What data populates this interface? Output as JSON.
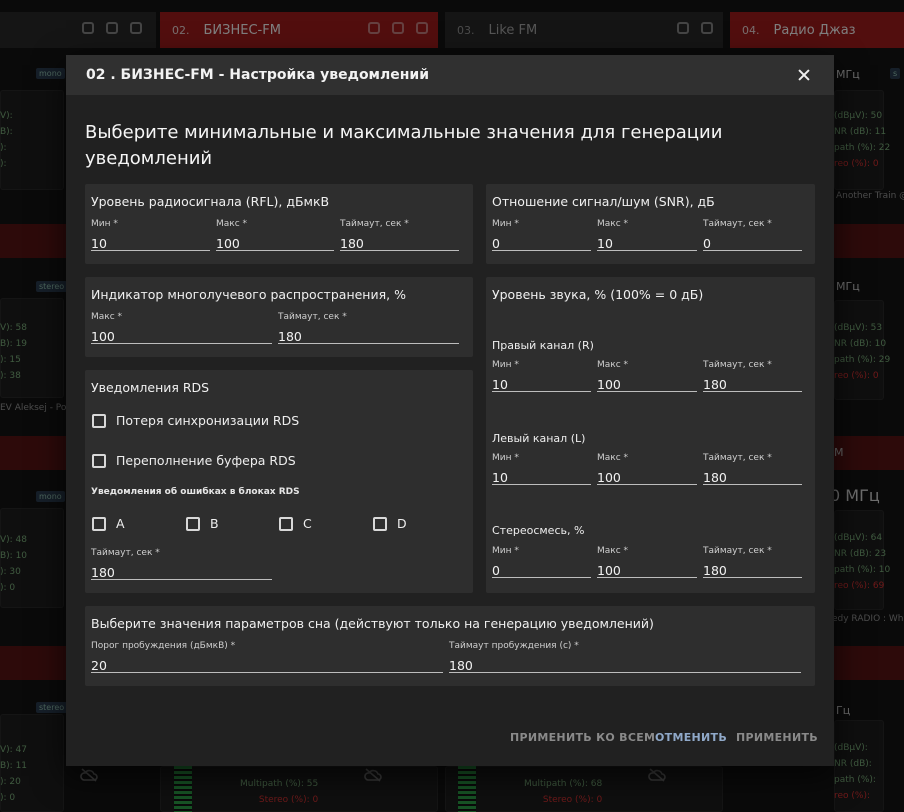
{
  "background": {
    "stations": [
      {
        "num": "02.",
        "name": "БИЗНЕС-FM"
      },
      {
        "num": "03.",
        "name": "Like FM"
      },
      {
        "num": "04.",
        "name": "Радио Джаз"
      }
    ],
    "tags": {
      "mono": "mono",
      "stereo": "stereo"
    },
    "freq_unit": "МГц",
    "freq_big": "0 МГц",
    "freq_mid": "Гц",
    "left_values": {
      "r1": [
        "V):",
        "B):",
        "):",
        "):"
      ],
      "r2": [
        "V): 58",
        "B): 19",
        "): 15",
        "): 38"
      ],
      "r3": [
        "V): 48",
        "B): 10",
        "): 30",
        "): 0"
      ],
      "r4": [
        "V): 47",
        "B): 11",
        "): 20",
        "): 0"
      ]
    },
    "right_values": {
      "r1": [
        "(dBµV): 50",
        "NR (dB): 11",
        "path (%): 22",
        "reo (%): 0"
      ],
      "r2": [
        "(dBµV): 53",
        "NR (dB): 10",
        "path (%): 29",
        "reo (%): 0"
      ],
      "r3": [
        "(dBµV): 64",
        "NR (dB): 23",
        "path (%): 10",
        "reo (%): 69"
      ],
      "r4": [
        "(dBµV):",
        "NR (dB):",
        "path (%):",
        "reo (%):"
      ]
    },
    "texts": {
      "another_train": "Another Train @",
      "aleksej": "EV Aleksej - Poz",
      "edy_radio": "edy RADIO : Wh",
      "multipath_1": "Multipath (%): 55",
      "stereo_1": "Stereo (%): 0",
      "multipath_2": "Multipath (%): 68",
      "stereo_2": "Stereo (%): 0",
      "m_letter": "M"
    }
  },
  "dialog": {
    "title": "02 . БИЗНЕС-FM - Настройка уведомлений",
    "heading": "Выберите минимальные и максимальные значения для генерации уведомлений",
    "rfl": {
      "title": "Уровень радиосигнала (RFL), дБмкВ",
      "min": {
        "label": "Мин *",
        "value": "10"
      },
      "max": {
        "label": "Макс *",
        "value": "100"
      },
      "timeout": {
        "label": "Таймаут, сек *",
        "value": "180"
      }
    },
    "snr": {
      "title": "Отношение сигнал/шум (SNR), дБ",
      "min": {
        "label": "Мин *",
        "value": "0"
      },
      "max": {
        "label": "Макс *",
        "value": "10"
      },
      "timeout": {
        "label": "Таймаут, сек *",
        "value": "0"
      }
    },
    "multipath": {
      "title": "Индикатор многолучевого распространения, %",
      "max": {
        "label": "Макс *",
        "value": "100"
      },
      "timeout": {
        "label": "Таймаут, сек *",
        "value": "180"
      }
    },
    "sound": {
      "title": "Уровень звука, % (100% = 0 дБ)",
      "right": {
        "title": "Правый канал (R)",
        "min": {
          "label": "Мин *",
          "value": "10"
        },
        "max": {
          "label": "Макс *",
          "value": "100"
        },
        "timeout": {
          "label": "Таймаут, сек *",
          "value": "180"
        }
      },
      "left": {
        "title": "Левый канал (L)",
        "min": {
          "label": "Мин *",
          "value": "10"
        },
        "max": {
          "label": "Макс *",
          "value": "100"
        },
        "timeout": {
          "label": "Таймаут, сек *",
          "value": "180"
        }
      },
      "stereo": {
        "title": "Стереосмесь, %",
        "min": {
          "label": "Мин *",
          "value": "0"
        },
        "max": {
          "label": "Макс *",
          "value": "100"
        },
        "timeout": {
          "label": "Таймаут, сек *",
          "value": "180"
        }
      }
    },
    "rds": {
      "title": "Уведомления RDS",
      "sync_loss": "Потеря синхронизации RDS",
      "buffer_overflow": "Переполнение буфера RDS",
      "block_errors_title": "Уведомления об ошибках в блоках RDS",
      "blocks": [
        "A",
        "B",
        "C",
        "D"
      ],
      "timeout": {
        "label": "Таймаут, сек *",
        "value": "180"
      }
    },
    "sleep": {
      "title": "Выберите значения параметров сна (действуют только на генерацию уведомлений)",
      "threshold": {
        "label": "Порог пробуждения (дБмкВ) *",
        "value": "20"
      },
      "wake_timeout": {
        "label": "Таймаут пробуждения (с) *",
        "value": "180"
      }
    },
    "actions": {
      "apply_all": "ПРИМЕНИТЬ КО ВСЕМ",
      "cancel": "ОТМЕНИТЬ",
      "apply": "ПРИМЕНИТЬ"
    },
    "colors": {
      "cancel": "#90a9c9",
      "disabled": "#8a8a8a"
    }
  }
}
